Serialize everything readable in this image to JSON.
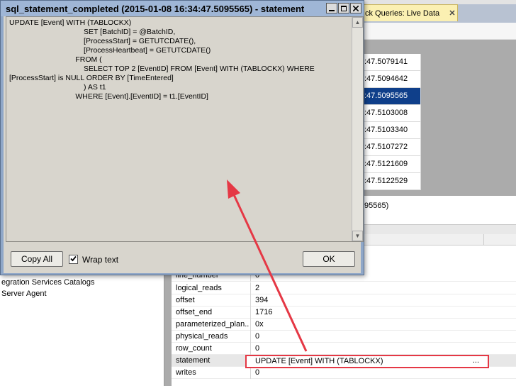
{
  "tab": {
    "label": "ck Queries: Live Data",
    "close_glyph": "✕"
  },
  "grid": {
    "times": [
      ":47.5079141",
      ":47.5094642",
      ":47.5095565",
      ":47.5103008",
      ":47.5103340",
      ":47.5107272",
      ":47.5121609",
      ":47.5122529"
    ],
    "selected_index": 2,
    "status_suffix": "95565)"
  },
  "tree": {
    "items": [
      "egration Services Catalogs",
      " Server Agent"
    ]
  },
  "properties": {
    "rows": [
      {
        "name": "line_number",
        "value": "0"
      },
      {
        "name": "logical_reads",
        "value": "2"
      },
      {
        "name": "offset",
        "value": "394"
      },
      {
        "name": "offset_end",
        "value": "1716"
      },
      {
        "name": "parameterized_plan...",
        "value": "0x"
      },
      {
        "name": "physical_reads",
        "value": "0"
      },
      {
        "name": "row_count",
        "value": "0"
      },
      {
        "name": "statement",
        "value": "UPDATE [Event] WITH (TABLOCKX)"
      },
      {
        "name": "writes",
        "value": "0"
      }
    ],
    "statement_ellipsis": "..."
  },
  "dialog": {
    "title": "sql_statement_completed (2015-01-08 16:34:47.5095565) - statement",
    "statement_text": "UPDATE [Event] WITH (TABLOCKX)\n                                    SET [BatchID] = @BatchID,\n                                    [ProcessStart] = GETUTCDATE(),\n                                    [ProcessHeartbeat] = GETUTCDATE()\n                                FROM (\n                                    SELECT TOP 2 [EventID] FROM [Event] WITH (TABLOCKX) WHERE\n[ProcessStart] is NULL ORDER BY [TimeEntered]\n                                    ) AS t1\n                                WHERE [Event].[EventID] = t1.[EventID]",
    "copy_all_label": "Copy All",
    "wrap_text_label": "Wrap text",
    "wrap_text_checked": true,
    "ok_label": "OK"
  },
  "colors": {
    "highlight": "#e53845",
    "selection": "#0f3f8a"
  }
}
